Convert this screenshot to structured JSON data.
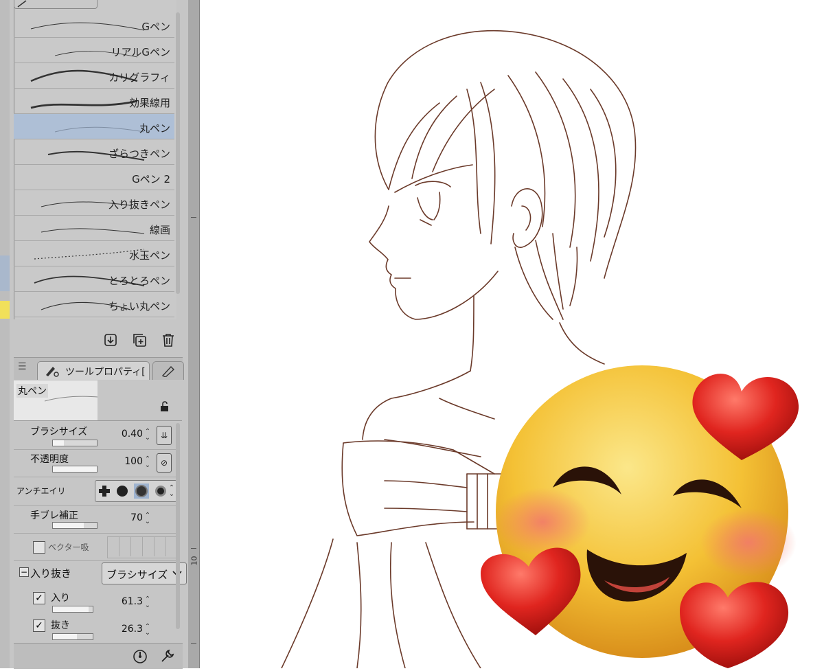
{
  "brush_list": {
    "items": [
      {
        "label": "Gペン"
      },
      {
        "label": "リアルGペン"
      },
      {
        "label": "カリグラフィ"
      },
      {
        "label": "効果線用"
      },
      {
        "label": "丸ペン",
        "selected": true
      },
      {
        "label": "ざらつきペン"
      },
      {
        "label": "Gペン 2"
      },
      {
        "label": "入り抜きペン"
      },
      {
        "label": "線画"
      },
      {
        "label": "水玉ペン"
      },
      {
        "label": "とろとろペン"
      },
      {
        "label": "ちょい丸ペン"
      }
    ],
    "icons": [
      "import-icon",
      "duplicate-icon",
      "trash-icon"
    ]
  },
  "tool_property": {
    "tab_label": "ツールプロパティ[",
    "preview_name": "丸ペン",
    "brush_size": {
      "label": "ブラシサイズ",
      "value": "0.40",
      "fill": 0.25
    },
    "opacity": {
      "label": "不透明度",
      "value": "100",
      "fill": 1.0
    },
    "antialias": {
      "label": "アンチエイリ",
      "selected_index": 2
    },
    "stabilization": {
      "label": "手ブレ補正",
      "value": "70",
      "fill": 0.7
    },
    "vector_snap": {
      "label": "ベクター吸"
    },
    "taper": {
      "label": "入り抜き",
      "dropdown": "ブラシサイズ",
      "checked": true
    },
    "taper_in": {
      "label": "入り",
      "value": "61.3",
      "checked": true,
      "fill": 0.9
    },
    "taper_out": {
      "label": "抜き",
      "value": "26.3",
      "checked": true,
      "fill": 0.6
    }
  },
  "ruler": {
    "label": "10"
  },
  "colors": {
    "line_art": "#6b3a2a",
    "selected_item": "#aebfd6",
    "panel_bg": "#c6c6c6",
    "emoji_face": "#f6c33a",
    "heart": "#e0251f"
  },
  "overlay": {
    "emoji": "smiling-face-with-hearts"
  }
}
